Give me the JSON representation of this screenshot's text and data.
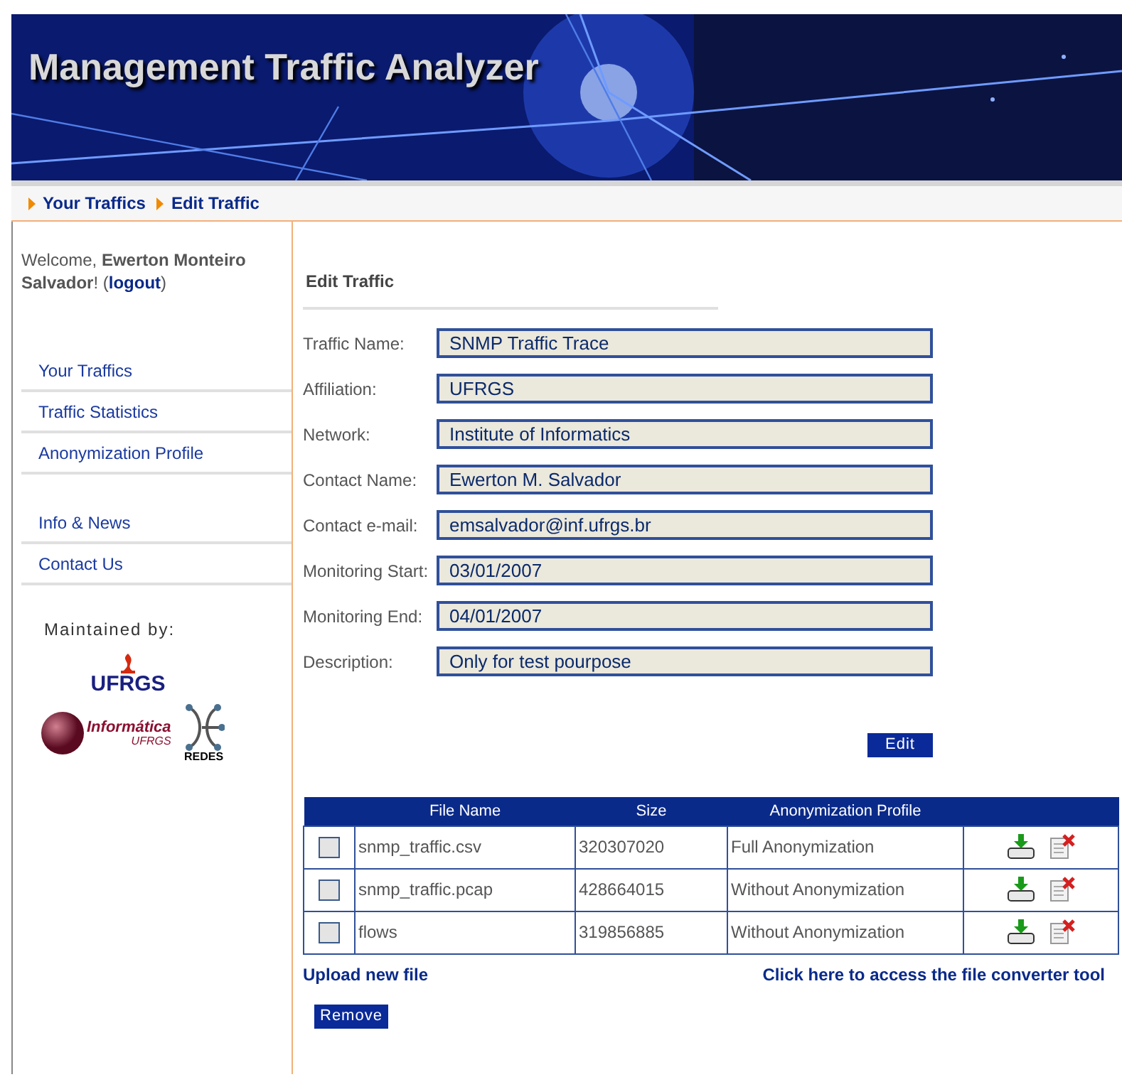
{
  "banner": {
    "title": "Management Traffic Analyzer"
  },
  "breadcrumb": [
    "Your Traffics",
    "Edit Traffic"
  ],
  "sidebar": {
    "welcome": "Welcome, **Ewerton Monteiro Salvador**! (",
    "logout": "logout",
    "welcome_end": ")",
    "menu_groups": [
      [
        "Your Traffics",
        "Traffic Statistics",
        "Anonymization Profile"
      ],
      [
        "Info & News",
        "Contact Us"
      ]
    ],
    "maintained_by": "Maintained by:",
    "logos": {
      "ufrgs": "UFRGS",
      "informatica": "Informática",
      "informatica_sub": "UFRGS",
      "redes": "REDES"
    }
  },
  "form": {
    "title": "Edit Traffic",
    "fields": [
      {
        "label": "Traffic Name:",
        "value": "SNMP Traffic Trace"
      },
      {
        "label": "Affiliation:",
        "value": "UFRGS"
      },
      {
        "label": "Network:",
        "value": "Institute of Informatics"
      },
      {
        "label": "Contact Name:",
        "value": "Ewerton M. Salvador"
      },
      {
        "label": "Contact e-mail:",
        "value": "emsalvador@inf.ufrgs.br"
      },
      {
        "label": "Monitoring Start:",
        "value": "03/01/2007"
      },
      {
        "label": "Monitoring End:",
        "value": "04/01/2007"
      },
      {
        "label": "Description:",
        "value": "Only for test pourpose"
      }
    ],
    "edit_button": "Edit"
  },
  "files": {
    "columns": [
      "File Name",
      "Size",
      "Anonymization Profile"
    ],
    "rows": [
      {
        "checked": false,
        "name": "snmp_traffic.csv",
        "size": "320307020",
        "profile": "Full Anonymization"
      },
      {
        "checked": false,
        "name": "snmp_traffic.pcap",
        "size": "428664015",
        "profile": "Without Anonymization"
      },
      {
        "checked": false,
        "name": "flows",
        "size": "319856885",
        "profile": "Without Anonymization"
      }
    ],
    "upload_link": "Upload new file",
    "converter_link": "Click here to access the file converter tool",
    "remove_button": "Remove"
  }
}
